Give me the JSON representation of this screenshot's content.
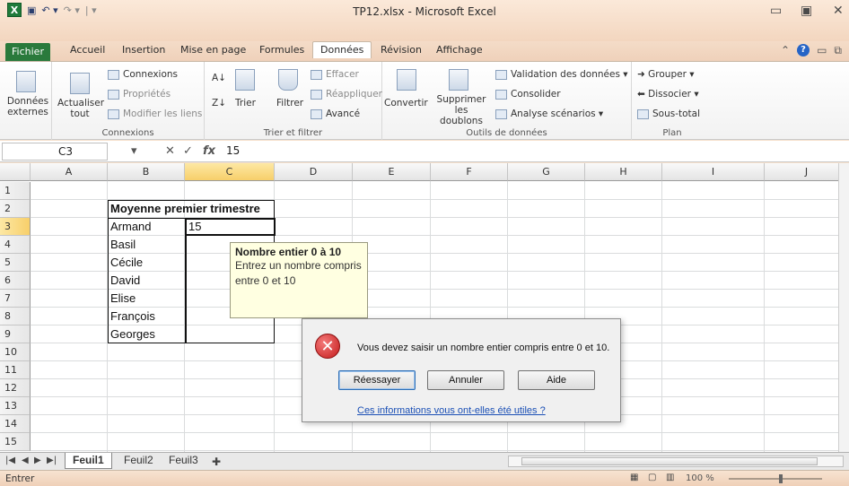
{
  "window": {
    "title": "TP12.xlsx - Microsoft Excel",
    "app_logo": "X"
  },
  "tabs": [
    {
      "label": "Fichier"
    },
    {
      "label": "Accueil"
    },
    {
      "label": "Insertion"
    },
    {
      "label": "Mise en page"
    },
    {
      "label": "Formules"
    },
    {
      "label": "Données"
    },
    {
      "label": "Révision"
    },
    {
      "label": "Affichage"
    }
  ],
  "ribbon": {
    "donnees_externes": "Données externes",
    "actualiser": "Actualiser tout",
    "connexions": "Connexions",
    "proprietes": "Propriétés",
    "modifier_liens": "Modifier les liens",
    "group_connexions": "Connexions",
    "trier": "Trier",
    "filtrer": "Filtrer",
    "effacer": "Effacer",
    "reappliquer": "Réappliquer",
    "avance": "Avancé",
    "group_trier": "Trier et filtrer",
    "convertir": "Convertir",
    "supprimer": "Supprimer les doublons",
    "validation": "Validation des données",
    "consolider": "Consolider",
    "analyse": "Analyse scénarios",
    "group_outils": "Outils de données",
    "grouper": "Grouper",
    "dissocier": "Dissocier",
    "sous_total": "Sous-total",
    "group_plan": "Plan"
  },
  "formula_bar": {
    "name_box": "C3",
    "value": "15"
  },
  "columns": [
    "A",
    "B",
    "C",
    "D",
    "E",
    "F",
    "G",
    "H",
    "I",
    "J"
  ],
  "rows": [
    "1",
    "2",
    "3",
    "4",
    "5",
    "6",
    "7",
    "8",
    "9",
    "10",
    "11",
    "12",
    "13",
    "14",
    "15"
  ],
  "sheet": {
    "header": "Moyenne premier trimestre",
    "names": [
      "Armand",
      "Basil",
      "Cécile",
      "David",
      "Elise",
      "François",
      "Georges"
    ],
    "c3_value": "15"
  },
  "tooltip": {
    "title": "Nombre entier 0 à 10",
    "line1": "Entrez un nombre compris",
    "line2": "entre 0 et 10"
  },
  "dialog": {
    "message": "Vous devez saisir un nombre entier compris entre 0 et 10.",
    "retry": "Réessayer",
    "cancel": "Annuler",
    "help": "Aide",
    "link": "Ces informations vous ont-elles été utiles ?"
  },
  "sheet_tabs": [
    "Feuil1",
    "Feuil2",
    "Feuil3"
  ],
  "status": {
    "mode": "Entrer",
    "zoom": "100 %"
  }
}
